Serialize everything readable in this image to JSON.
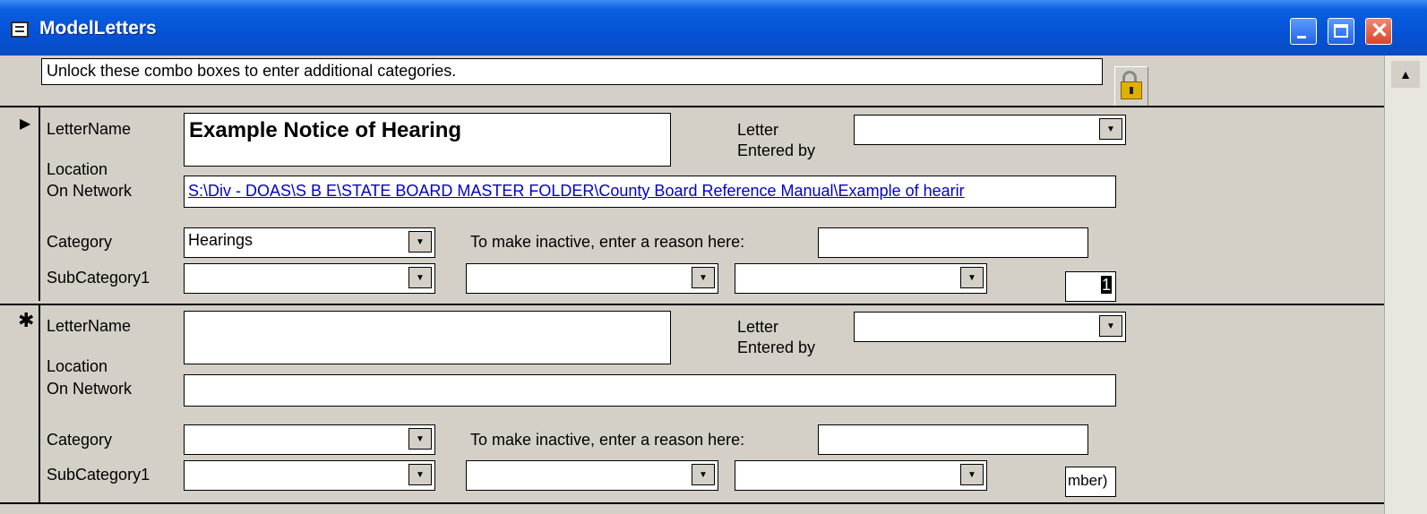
{
  "window": {
    "title": "ModelLetters"
  },
  "header": {
    "note": "Unlock these combo boxes to enter additional categories.",
    "lock_icon": "padlock-icon"
  },
  "records": [
    {
      "marker": "▶",
      "letter_name_label": "LetterName",
      "letter_name": "Example Notice of Hearing",
      "entered_by_label1": "Letter",
      "entered_by_label2": "Entered by",
      "entered_by": "",
      "location_label1": "Location",
      "location_label2": "On Network",
      "location": "S:\\Div - DOAS\\S B E\\STATE BOARD MASTER FOLDER\\County Board Reference Manual\\Example of hearir",
      "category_label": "Category",
      "category": "Hearings",
      "inactive_label": "To make inactive, enter a reason here:",
      "inactive_reason": "",
      "subcat_label": "SubCategory1",
      "subcat1": "",
      "subcat2": "",
      "subcat3": "",
      "number": "1"
    },
    {
      "marker": "✱",
      "letter_name_label": "LetterName",
      "letter_name": "",
      "entered_by_label1": "Letter",
      "entered_by_label2": "Entered by",
      "entered_by": "",
      "location_label1": "Location",
      "location_label2": "On Network",
      "location": "",
      "category_label": "Category",
      "category": "",
      "inactive_label": "To make inactive, enter a reason here:",
      "inactive_reason": "",
      "subcat_label": "SubCategory1",
      "subcat1": "",
      "subcat2": "",
      "subcat3": "",
      "number": "mber)"
    }
  ],
  "colors": {
    "titlebar": "#0552d6",
    "form_bg": "#d4d0c8",
    "link": "#0000cc",
    "close": "#d6472a"
  }
}
